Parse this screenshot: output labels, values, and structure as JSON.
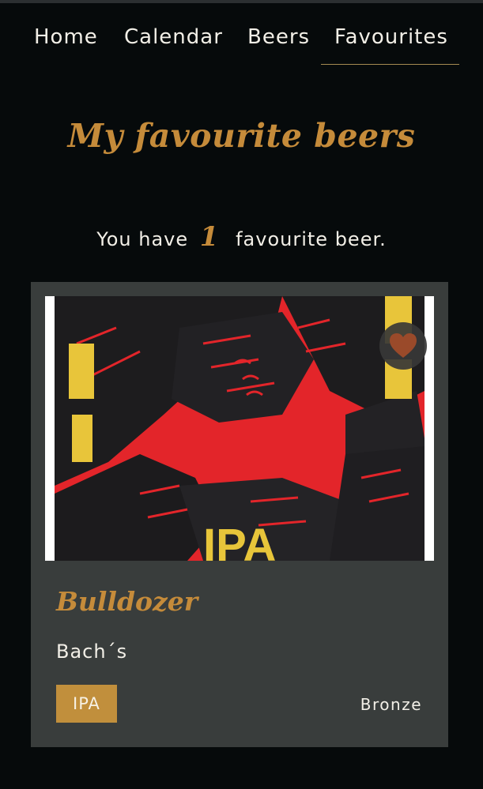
{
  "nav": {
    "items": [
      {
        "label": "Home"
      },
      {
        "label": "Calendar"
      },
      {
        "label": "Beers"
      },
      {
        "label": "Favourites",
        "active": true
      }
    ]
  },
  "heading": {
    "title": "My favourite beers"
  },
  "summary": {
    "prefix": "You have",
    "count": "1",
    "suffix": "favourite beer."
  },
  "favourites": [
    {
      "name": "Bulldozer",
      "brewery": "Bach´s",
      "style": "IPA",
      "medal": "Bronze",
      "image_text": "IPA",
      "is_favourite": true,
      "icon": "heart-icon"
    }
  ],
  "colors": {
    "background": "#060a0b",
    "accent": "#c58b3a",
    "card": "#393d3c",
    "badge": "#c18f3c",
    "heart": "#9a4a2a"
  }
}
